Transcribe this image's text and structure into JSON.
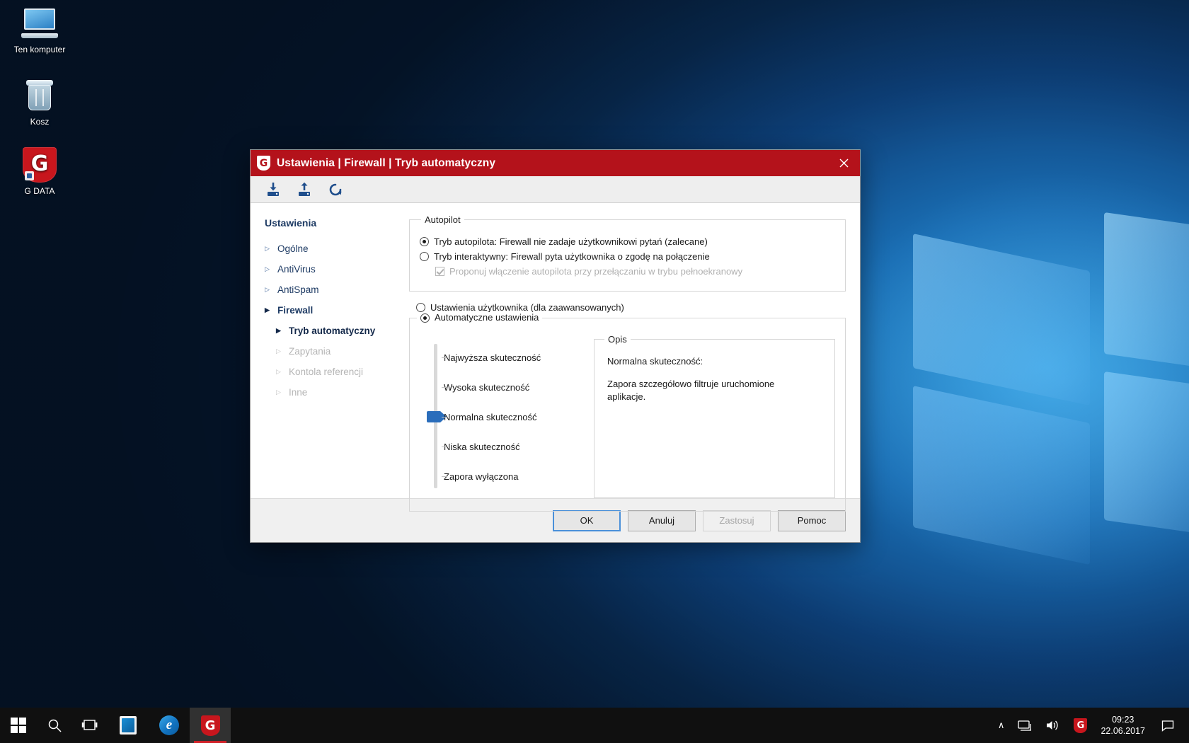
{
  "desktop": {
    "icons": [
      {
        "label": "Ten komputer",
        "icon": "computer-icon"
      },
      {
        "label": "Kosz",
        "icon": "recycle-bin-icon"
      },
      {
        "label": "G DATA",
        "icon": "gdata-logo-icon"
      }
    ]
  },
  "taskbar": {
    "start_label": "start-button",
    "search_label": "search-icon",
    "taskview_label": "task-view-icon",
    "apps": [
      {
        "name": "store",
        "label": "Sklep Microsoft"
      },
      {
        "name": "edge",
        "label": "Microsoft Edge",
        "glyph": "e"
      },
      {
        "name": "gdata",
        "label": "G DATA",
        "glyph": "G",
        "active": true
      }
    ],
    "tray": {
      "chevron": "∧",
      "network_label": "network-icon",
      "volume_label": "volume-icon",
      "gdata_label": "G"
    },
    "clock": {
      "time": "09:23",
      "date": "22.06.2017"
    }
  },
  "dialog": {
    "title": "Ustawienia | Firewall | Tryb automatyczny",
    "logo_glyph": "G",
    "close_label": "✕",
    "toolbar": [
      {
        "name": "import-settings-button",
        "label": "Importuj ustawienia"
      },
      {
        "name": "export-settings-button",
        "label": "Eksportuj ustawienia"
      },
      {
        "name": "reset-settings-button",
        "label": "Przywróć ustawienia domyślne"
      }
    ],
    "sidebar": {
      "title": "Ustawienia",
      "items": [
        {
          "label": "Ogólne",
          "level": 1,
          "state": "normal",
          "arrow": "▷"
        },
        {
          "label": "AntiVirus",
          "level": 1,
          "state": "normal",
          "arrow": "▷"
        },
        {
          "label": "AntiSpam",
          "level": 1,
          "state": "normal",
          "arrow": "▷"
        },
        {
          "label": "Firewall",
          "level": 1,
          "state": "open",
          "arrow": "▶"
        },
        {
          "label": "Tryb automatyczny",
          "level": 2,
          "state": "selected",
          "arrow": "▶"
        },
        {
          "label": "Zapytania",
          "level": 2,
          "state": "disabled",
          "arrow": "▷"
        },
        {
          "label": "Kontola referencji",
          "level": 2,
          "state": "disabled",
          "arrow": "▷"
        },
        {
          "label": "Inne",
          "level": 2,
          "state": "disabled",
          "arrow": "▷"
        }
      ]
    },
    "autopilot": {
      "legend": "Autopilot",
      "option_auto": "Tryb autopilota: Firewall nie zadaje użytkownikowi pytań (zalecane)",
      "option_interactive": "Tryb interaktywny: Firewall pyta użytkownika o zgodę na połączenie",
      "checkbox_fullscreen": "Proponuj włączenie autopilota przy przełączaniu w trybu pełnoekranowy",
      "selected": "auto",
      "checkbox_checked": true,
      "checkbox_disabled": true
    },
    "mode": {
      "option_user": "Ustawienia użytkownika (dla zaawansowanych)",
      "option_auto": "Automatyczne ustawienia",
      "selected": "auto"
    },
    "slider": {
      "steps": [
        "Najwyższa skuteczność",
        "Wysoka skuteczność",
        "Normalna skuteczność",
        "Niska skuteczność",
        "Zapora wyłączona"
      ],
      "selected_index": 2,
      "thumb_color": "#2a6dbb"
    },
    "description": {
      "legend": "Opis",
      "title": "Normalna skuteczność:",
      "body": "Zapora szczegółowo filtruje uruchomione aplikacje."
    },
    "buttons": [
      {
        "name": "ok-button",
        "label": "OK",
        "state": "focused"
      },
      {
        "name": "cancel-button",
        "label": "Anuluj",
        "state": "normal"
      },
      {
        "name": "apply-button",
        "label": "Zastosuj",
        "state": "disabled"
      },
      {
        "name": "help-button",
        "label": "Pomoc",
        "state": "normal"
      }
    ]
  },
  "colors": {
    "brand_red": "#b4121b",
    "accent_blue": "#2a6dbb",
    "nav_text": "#1d3a63"
  }
}
